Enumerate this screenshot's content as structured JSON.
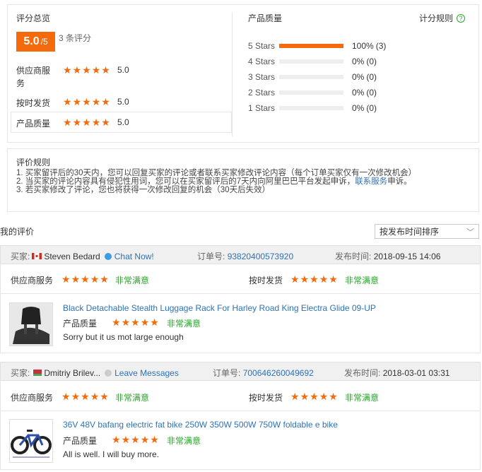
{
  "summary": {
    "title": "评分总览",
    "score": "5.0",
    "score_denom": "/5",
    "review_count": "3 条评分",
    "rows": [
      {
        "label1": "供应商服",
        "label2": "务",
        "value": "5.0",
        "stars": 5
      },
      {
        "label1": "按时发货",
        "label2": "",
        "value": "5.0",
        "stars": 5
      },
      {
        "label1": "产品质量",
        "label2": "",
        "value": "5.0",
        "stars": 5
      }
    ]
  },
  "quality": {
    "title": "产品质量",
    "rules_link": "计分规则",
    "rows": [
      {
        "label": "5 Stars",
        "pct": "100%",
        "count": "(3)",
        "fill": 1.0
      },
      {
        "label": "4 Stars",
        "pct": "0%",
        "count": "(0)",
        "fill": 0
      },
      {
        "label": "3 Stars",
        "pct": "0%",
        "count": "(0)",
        "fill": 0
      },
      {
        "label": "2 Stars",
        "pct": "0%",
        "count": "(0)",
        "fill": 0
      },
      {
        "label": "1 Stars",
        "pct": "0%",
        "count": "(0)",
        "fill": 0
      }
    ]
  },
  "rules": {
    "title": "评价规则",
    "line1": "1. 买家留评后的30天内，您可以回复买家的评论或者联系买家修改评论内容（每个订单买家仅有一次修改机会）",
    "line2_pre": "2. 当买家的评论内容具有侵犯性用词，您可以在买家留评后的7天内向阿里巴巴平台发起申诉，",
    "line2_link": "联系服务",
    "line2_post": "申诉。",
    "line3": "3. 若买家修改了评论，您也将获得一次修改回复的机会（30天后失效）"
  },
  "my_reviews": {
    "title": "我的评价",
    "sort_value": "按发布时间排序"
  },
  "reviews": [
    {
      "buyer_label": "买家:",
      "buyer_name": "Steven Bedard",
      "contact": "Chat Now!",
      "order_label": "订单号:",
      "order_no": "93820400573920",
      "time_label": "发布时间:",
      "time": "2018-09-15 14:06",
      "service_label": "供应商服务",
      "service_text": "非常满意",
      "ship_label": "按时发货",
      "ship_text": "非常满意",
      "product_title": "Black Detachable Stealth Luggage Rack For Harley Road King Electra Glide 09-UP",
      "quality_label": "产品质量",
      "quality_text": "非常满意",
      "comment": "Sorry but it us mot large enough"
    },
    {
      "buyer_label": "买家:",
      "buyer_name": "Dmitriy Brilev...",
      "contact": "Leave Messages",
      "order_label": "订单号:",
      "order_no": "700646260049692",
      "time_label": "发布时间:",
      "time": "2018-03-01 03:31",
      "service_label": "供应商服务",
      "service_text": "非常满意",
      "ship_label": "按时发货",
      "ship_text": "非常满意",
      "product_title": "36V 48V bafang electric fat bike 250W 350W 500W 750W foldable e bike",
      "quality_label": "产品质量",
      "quality_text": "非常满意",
      "comment": "All is well. I will buy more."
    }
  ],
  "colors": {
    "accent": "#f56a0a",
    "link": "#2d72b9",
    "green": "#2aa52a"
  }
}
